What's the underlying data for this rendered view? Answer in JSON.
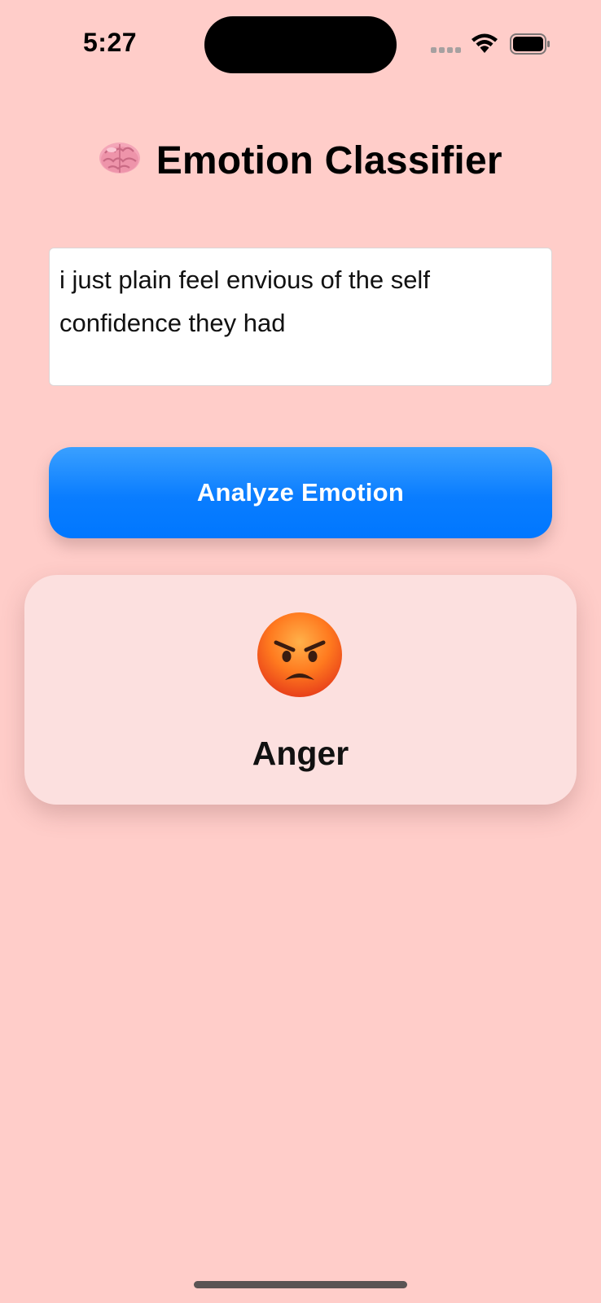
{
  "status_bar": {
    "time": "5:27",
    "icons": [
      "signal-icon",
      "wifi-icon",
      "battery-icon"
    ]
  },
  "header": {
    "icon": "brain-icon",
    "title": "Emotion Classifier"
  },
  "input": {
    "value": "i just plain feel envious of the self confidence they had"
  },
  "analyze_button": {
    "label": "Analyze Emotion"
  },
  "result": {
    "icon": "angry-face-icon",
    "emotion": "Anger"
  },
  "colors": {
    "background": "#ffcdc9",
    "button_blue": "#0a7dff",
    "card": "#fce0df"
  }
}
